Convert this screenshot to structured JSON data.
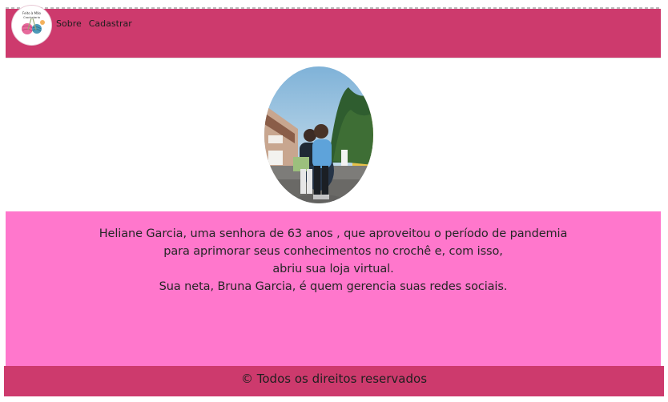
{
  "header": {
    "logo": {
      "text_line1": "Feito à Mão",
      "text_line2": "Crochetaria"
    },
    "nav": [
      {
        "label": "Sobre"
      },
      {
        "label": "Cadastrar"
      }
    ],
    "colors": {
      "header_bg": "#cd3a6d",
      "about_bg": "#ff77cc",
      "footer_bg": "#cd3a6d"
    }
  },
  "hero": {
    "image_icon": "portrait-photo"
  },
  "about": {
    "lines": [
      "Heliane Garcia, uma senhora de 63 anos , que aproveitou o período de pandemia",
      "para aprimorar seus conhecimentos no crochê e, com isso,",
      "abriu sua loja virtual.",
      "Sua neta, Bruna Garcia, é quem gerencia suas redes sociais."
    ]
  },
  "footer": {
    "text": "© Todos os direitos reservados"
  }
}
